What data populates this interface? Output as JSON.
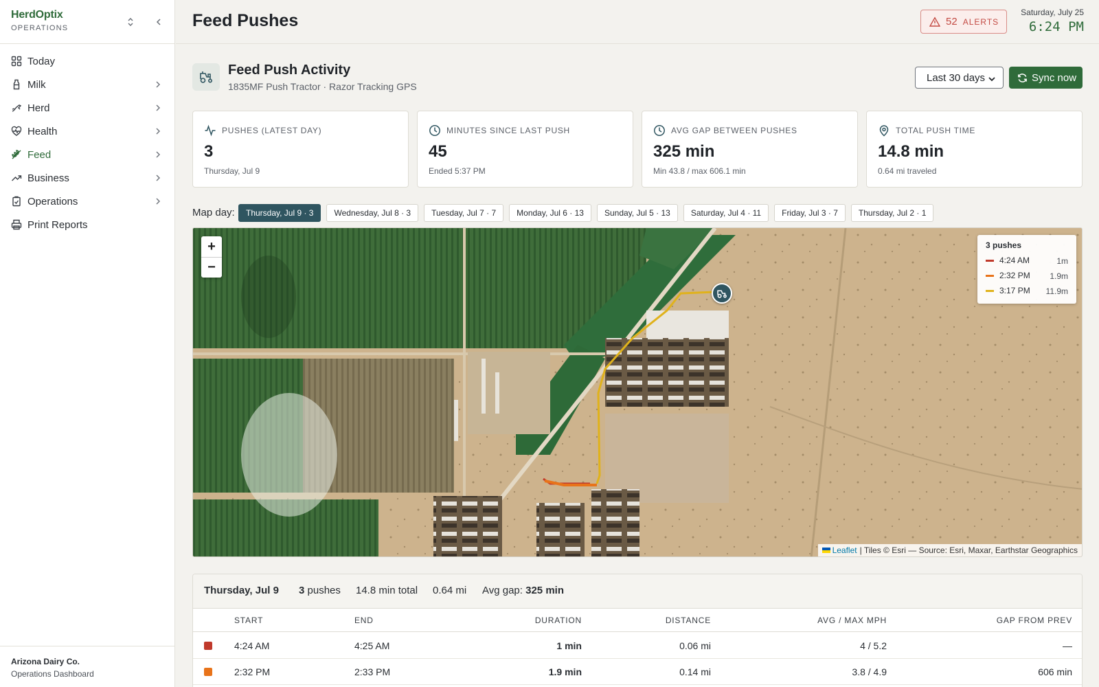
{
  "brand": {
    "name": "HerdOptix",
    "sub": "OPERATIONS"
  },
  "nav": [
    {
      "label": "Today",
      "icon": "grid-icon",
      "has_children": false
    },
    {
      "label": "Milk",
      "icon": "milk-bottle-icon",
      "has_children": true
    },
    {
      "label": "Herd",
      "icon": "cow-icon",
      "has_children": true
    },
    {
      "label": "Health",
      "icon": "heart-pulse-icon",
      "has_children": true
    },
    {
      "label": "Feed",
      "icon": "wheat-icon",
      "has_children": true,
      "active": true
    },
    {
      "label": "Business",
      "icon": "trending-up-icon",
      "has_children": true
    },
    {
      "label": "Operations",
      "icon": "clipboard-check-icon",
      "has_children": true
    },
    {
      "label": "Print Reports",
      "icon": "printer-icon",
      "has_children": false
    }
  ],
  "org": {
    "name": "Arizona Dairy Co.",
    "sub": "Operations Dashboard"
  },
  "header": {
    "title": "Feed Pushes",
    "alerts_count": "52",
    "alerts_label": "ALERTS",
    "date": "Saturday, July 25",
    "time": "6:24 PM"
  },
  "section": {
    "title": "Feed Push Activity",
    "subtitle": "1835MF Push Tractor · Razor Tracking GPS",
    "range_selected": "Last 30 days",
    "sync_label": "Sync now"
  },
  "stats": [
    {
      "label": "PUSHES (LATEST DAY)",
      "value": "3",
      "sub": "Thursday, Jul 9",
      "icon": "activity-icon"
    },
    {
      "label": "MINUTES SINCE LAST PUSH",
      "value": "45",
      "sub": "Ended 5:37 PM",
      "icon": "clock-icon"
    },
    {
      "label": "AVG GAP BETWEEN PUSHES",
      "value": "325 min",
      "sub": "Min 43.8 / max 606.1 min",
      "icon": "clock-icon"
    },
    {
      "label": "TOTAL PUSH TIME",
      "value": "14.8 min",
      "sub": "0.64 mi traveled",
      "icon": "map-pin-icon"
    }
  ],
  "map_day": {
    "label": "Map day:",
    "days": [
      {
        "label": "Thursday, Jul 9 · 3",
        "active": true
      },
      {
        "label": "Wednesday, Jul 8 · 3"
      },
      {
        "label": "Tuesday, Jul 7 · 7"
      },
      {
        "label": "Monday, Jul 6 · 13"
      },
      {
        "label": "Sunday, Jul 5 · 13"
      },
      {
        "label": "Saturday, Jul 4 · 11"
      },
      {
        "label": "Friday, Jul 3 · 7"
      },
      {
        "label": "Thursday, Jul 2 · 1"
      }
    ]
  },
  "map": {
    "zoom_in": "+",
    "zoom_out": "−",
    "legend_title": "3 pushes",
    "legend": [
      {
        "time": "4:24 AM",
        "dur": "1m",
        "color": "#c0392b"
      },
      {
        "time": "2:32 PM",
        "dur": "1.9m",
        "color": "#e8731a"
      },
      {
        "time": "3:17 PM",
        "dur": "11.9m",
        "color": "#e0b21b"
      }
    ],
    "attribution_link": "Leaflet",
    "attribution_rest": "| Tiles © Esri — Source: Esri, Maxar, Earthstar Geographics"
  },
  "day_table": {
    "day": "Thursday, Jul 9",
    "pushes_count": "3",
    "pushes_label": "pushes",
    "total": "14.8 min total",
    "distance": "0.64 mi",
    "avg_gap_label": "Avg gap:",
    "avg_gap_value": "325 min",
    "columns": [
      "START",
      "END",
      "DURATION",
      "DISTANCE",
      "AVG / MAX MPH",
      "GAP FROM PREV"
    ],
    "rows": [
      {
        "color": "#c0392b",
        "start": "4:24 AM",
        "end": "4:25 AM",
        "duration": "1 min",
        "distance": "0.06 mi",
        "mph": "4 / 5.2",
        "gap": "—"
      },
      {
        "color": "#e8731a",
        "start": "2:32 PM",
        "end": "2:33 PM",
        "duration": "1.9 min",
        "distance": "0.14 mi",
        "mph": "3.8 / 4.9",
        "gap": "606 min"
      }
    ]
  }
}
